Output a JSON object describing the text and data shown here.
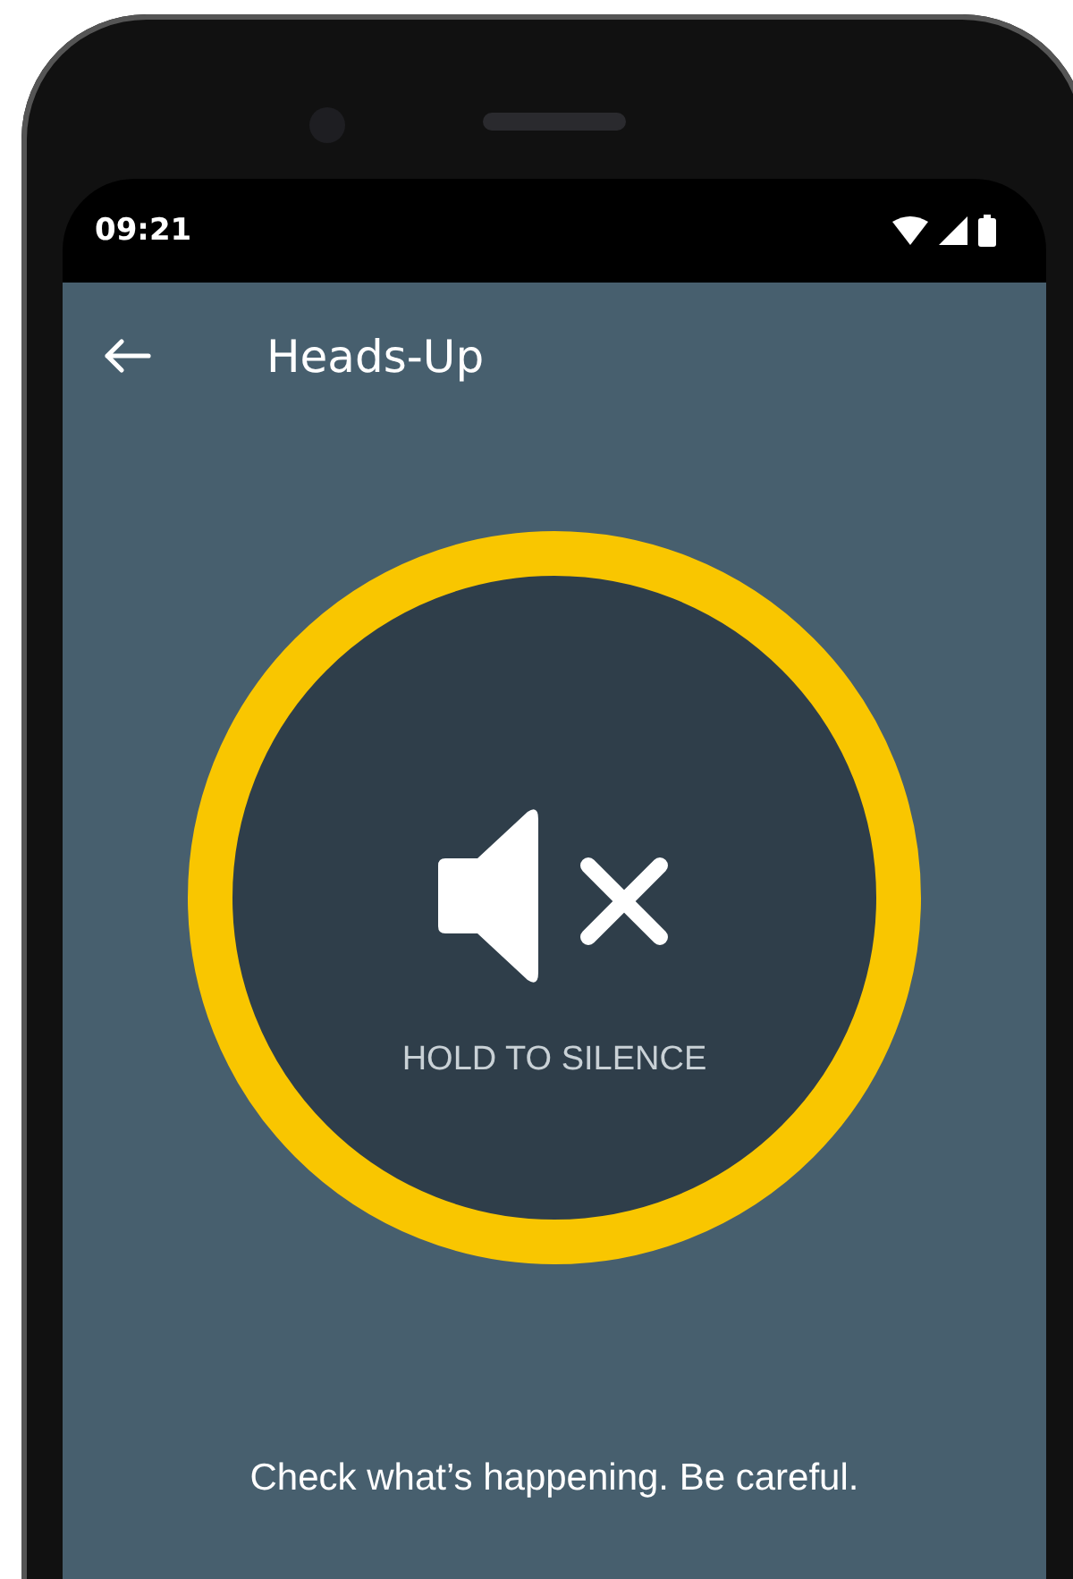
{
  "status_bar": {
    "time": "09:21"
  },
  "app_bar": {
    "title": "Heads-Up"
  },
  "silence_button": {
    "label": "HOLD TO SILENCE"
  },
  "message": "Check what’s happening. Be careful."
}
